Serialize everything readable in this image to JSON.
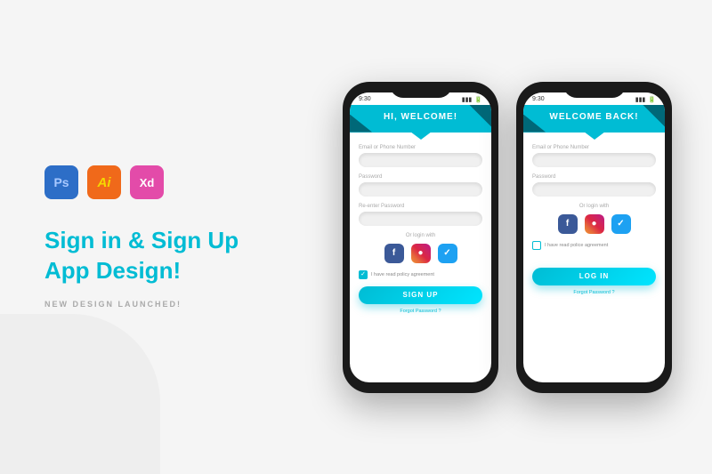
{
  "left": {
    "tools": [
      {
        "label": "Ps",
        "class": "tool-ps",
        "inner_label": "Ps"
      },
      {
        "label": "Ai",
        "class": "tool-ai",
        "inner_label": "Ai"
      },
      {
        "label": "Xd",
        "class": "tool-xd",
        "inner_label": "Xd"
      }
    ],
    "title_line1": "Sign in & Sign Up",
    "title_line2": "App Design!",
    "subtitle": "NEW DESIGN LAUNCHED!"
  },
  "phones": [
    {
      "id": "signup",
      "status_time": "9:30",
      "status_signal": "▮▮▮",
      "status_battery": "70%",
      "header_title": "HI, WELCOME!",
      "form_fields": [
        {
          "label": "Email or Phone Number",
          "placeholder": ""
        },
        {
          "label": "Password",
          "placeholder": ""
        },
        {
          "label": "Re-enter Password",
          "placeholder": ""
        }
      ],
      "or_text": "Or login with",
      "social": [
        "f",
        "✦",
        "✈"
      ],
      "policy_checked": true,
      "policy_text": "I have read policy agreement",
      "button_label": "SIGN UP",
      "forgot_text": "Forgot Password ?"
    },
    {
      "id": "login",
      "status_time": "9:30",
      "status_signal": "▮▮▮",
      "status_battery": "70%",
      "header_title": "WELCOME BACK!",
      "form_fields": [
        {
          "label": "Email or Phone Number",
          "placeholder": ""
        },
        {
          "label": "Password",
          "placeholder": ""
        }
      ],
      "or_text": "Or login with",
      "social": [
        "f",
        "✦",
        "✈"
      ],
      "policy_checked": false,
      "policy_text": "I have read police agreement",
      "button_label": "LOG IN",
      "forgot_text": "Forgot Password ?"
    }
  ]
}
